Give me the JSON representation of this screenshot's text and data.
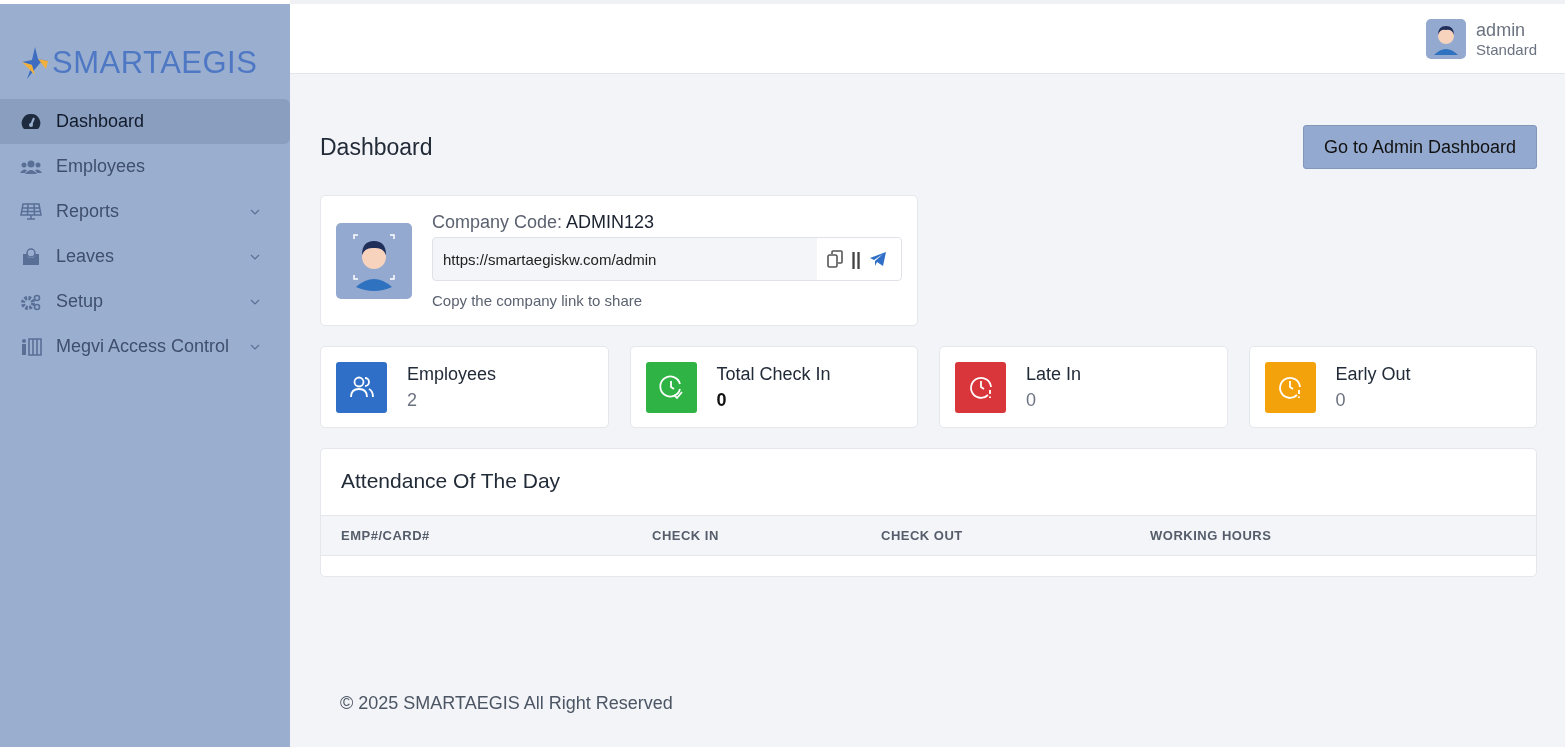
{
  "logo": {
    "text": "SMARTAEGIS"
  },
  "sidebar": {
    "items": [
      {
        "label": "Dashboard",
        "kind": "gauge",
        "selected": true,
        "expandable": false
      },
      {
        "label": "Employees",
        "kind": "people",
        "selected": false,
        "expandable": false
      },
      {
        "label": "Reports",
        "kind": "panel",
        "selected": false,
        "expandable": true
      },
      {
        "label": "Leaves",
        "kind": "tray",
        "selected": false,
        "expandable": true
      },
      {
        "label": "Setup",
        "kind": "gears",
        "selected": false,
        "expandable": true
      },
      {
        "label": "Megvi Access Control",
        "kind": "door",
        "selected": false,
        "expandable": true
      }
    ]
  },
  "user": {
    "name": "admin",
    "role": "Standard"
  },
  "page_title": "Dashboard",
  "admin_button": "Go to Admin Dashboard",
  "company": {
    "label": "Company Code:",
    "code": "ADMIN123",
    "link": "https://smartaegiskw.com/admin",
    "divider": "||",
    "hint": "Copy the company link to share"
  },
  "stats": [
    {
      "label": "Employees",
      "value": "2",
      "kind": "people",
      "color": "#2f6fc7",
      "emphasis": false
    },
    {
      "label": "Total Check In",
      "value": "0",
      "kind": "clock-check",
      "color": "#2fb345",
      "emphasis": true
    },
    {
      "label": "Late In",
      "value": "0",
      "kind": "clock-alert",
      "color": "#d8363a",
      "emphasis": false
    },
    {
      "label": "Early Out",
      "value": "0",
      "kind": "clock-alert",
      "color": "#f4a20c",
      "emphasis": false
    }
  ],
  "attendance": {
    "title": "Attendance Of The Day",
    "columns": [
      "EMP#/CARD#",
      "CHECK IN",
      "CHECK OUT",
      "WORKING HOURS"
    ]
  },
  "footer": "© 2025 SMARTAEGIS All Right Reserved"
}
